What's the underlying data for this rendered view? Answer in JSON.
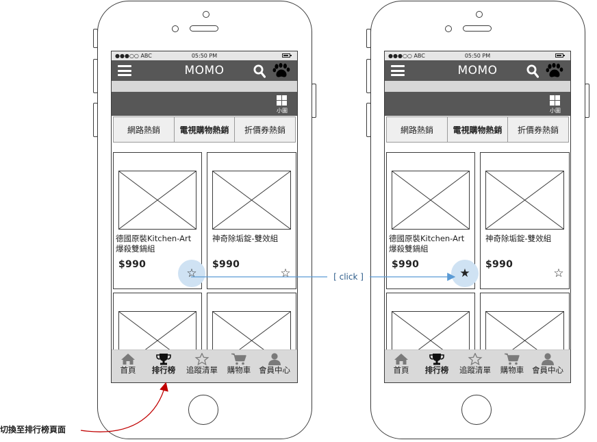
{
  "status": {
    "signal": "●●●○○ ABC",
    "time": "05:50 PM"
  },
  "app": {
    "title": "MOMO"
  },
  "toolbar": {
    "grid_label": "小圖"
  },
  "tabs": [
    {
      "label": "網路熱銷"
    },
    {
      "label": "電視購物熱銷"
    },
    {
      "label": "折價券熱銷"
    }
  ],
  "products": [
    {
      "name": "德國原裝Kitchen-Art 爆殺雙鍋組",
      "price": "$990"
    },
    {
      "name": "神奇除垢錠-雙效組",
      "price": "$990"
    }
  ],
  "tabbar": [
    {
      "label": "首頁",
      "icon": "home-icon"
    },
    {
      "label": "排行榜",
      "icon": "trophy-icon"
    },
    {
      "label": "追蹤清單",
      "icon": "star-icon"
    },
    {
      "label": "購物車",
      "icon": "cart-icon"
    },
    {
      "label": "會員中心",
      "icon": "user-icon"
    }
  ],
  "annotations": {
    "click": "[ click ]",
    "switch_caption": "切換至排行榜頁面"
  },
  "colors": {
    "header": "#575757",
    "highlight": "#cfe2f3",
    "connector": "#5b9bd5",
    "caption_arrow": "#c00000"
  }
}
